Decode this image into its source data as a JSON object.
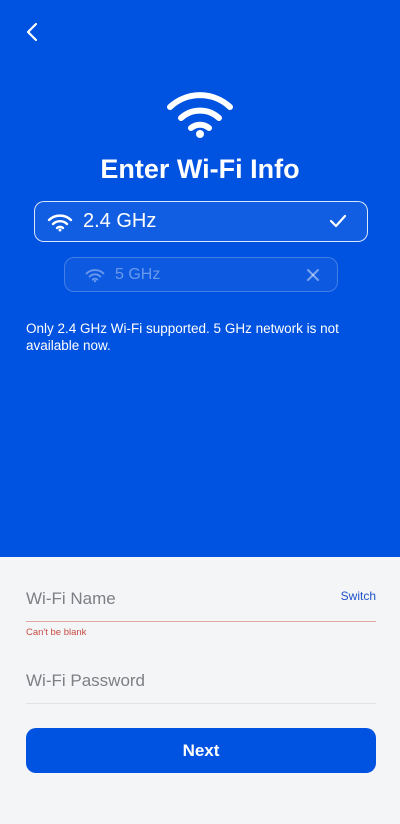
{
  "header": {
    "back_icon": "chevron-left-icon",
    "hero_icon": "wifi-icon",
    "title": "Enter Wi-Fi Info"
  },
  "bands": [
    {
      "label": "2.4 GHz",
      "icon": "wifi-icon",
      "status_icon": "checkmark-icon",
      "selected": true
    },
    {
      "label": "5 GHz",
      "icon": "wifi-icon",
      "status_icon": "close-icon",
      "selected": false
    }
  ],
  "notice": "Only 2.4 GHz Wi-Fi supported. 5 GHz network is not available now.",
  "form": {
    "wifi_name": {
      "placeholder": "Wi-Fi Name",
      "value": "",
      "switch_label": "Switch",
      "error": "Can't be blank"
    },
    "wifi_password": {
      "placeholder": "Wi-Fi Password",
      "value": ""
    }
  },
  "next_label": "Next",
  "colors": {
    "primary": "#0052e0",
    "background": "#f4f5f7",
    "error": "#c94c44",
    "link": "#1d52c8"
  }
}
